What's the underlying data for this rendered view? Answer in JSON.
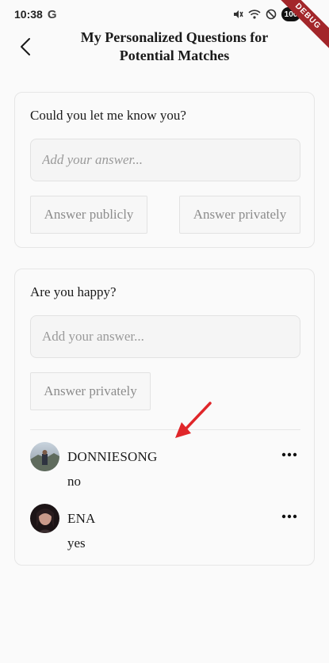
{
  "status_bar": {
    "time": "10:38",
    "g_label": "G",
    "battery": "100",
    "debug_label": "DEBUG"
  },
  "header": {
    "title": "My Personalized Questions for Potential Matches"
  },
  "questions": [
    {
      "question": "Could you let me know you?",
      "answer_placeholder": "Add your answer...",
      "answer_value": "",
      "public_button": "Answer publicly",
      "private_button": "Answer privately"
    },
    {
      "question": "Are you happy?",
      "answer_placeholder": "Add your answer...",
      "answer_value": "",
      "private_button": "Answer privately",
      "replies": [
        {
          "name": "DONNIESONG",
          "text": "no",
          "avatar": "donniesong-avatar"
        },
        {
          "name": "ENA",
          "text": "yes",
          "avatar": "ena-avatar"
        }
      ]
    }
  ],
  "icons": {
    "back": "back-chevron-icon",
    "more": "more-dots-icon",
    "annotation": "red-arrow-annotation"
  },
  "colors": {
    "annotation_red": "#e0262a",
    "debug_banner": "#a3262a"
  }
}
